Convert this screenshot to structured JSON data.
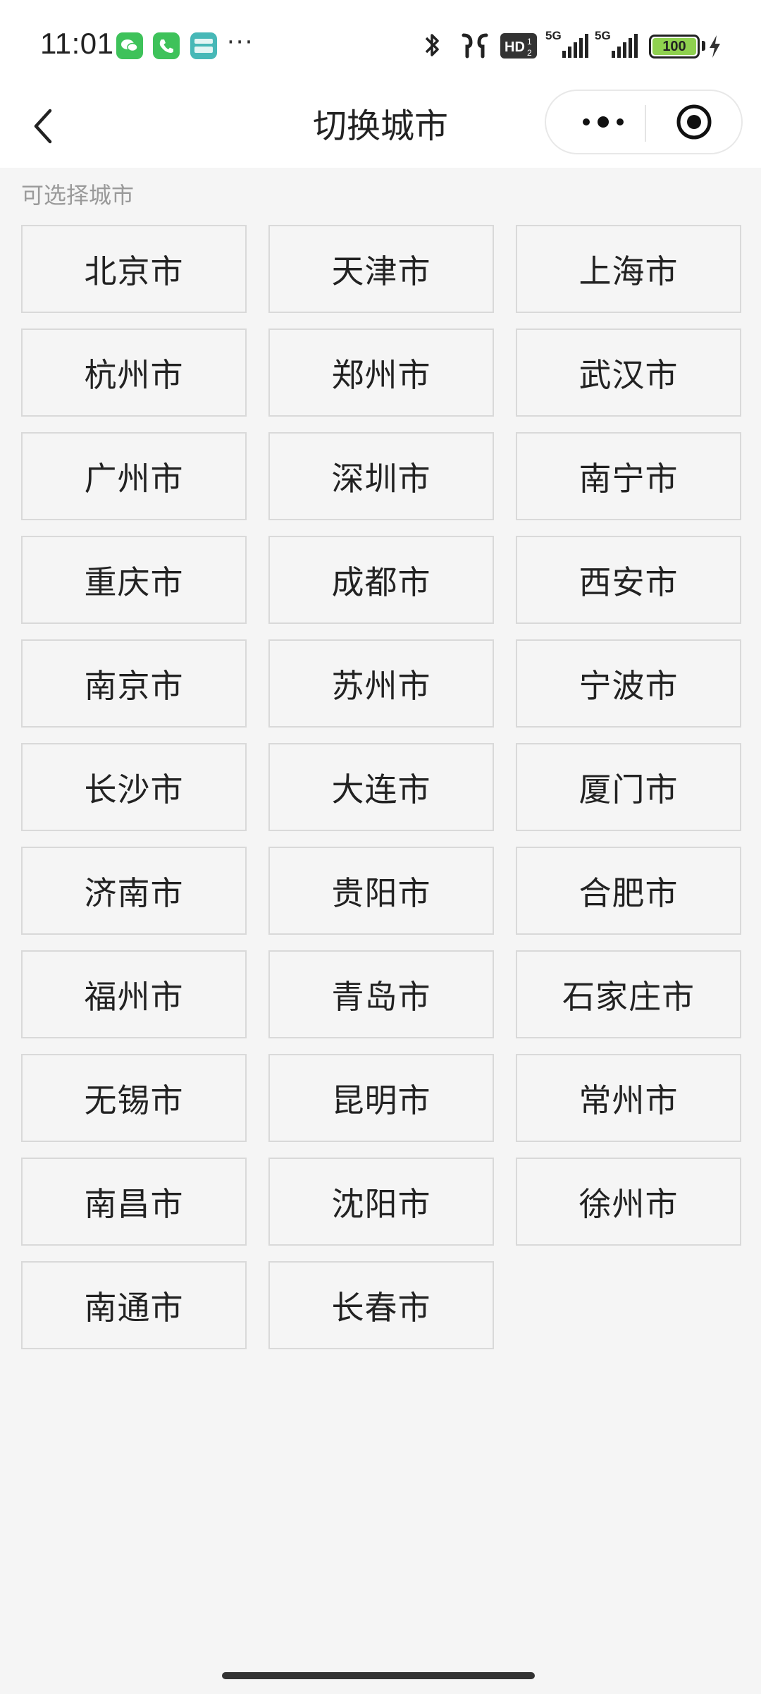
{
  "status_bar": {
    "time": "11:01",
    "notification_icons": [
      "wechat-icon",
      "phone-icon",
      "boss-zhipin-icon"
    ],
    "more": "···",
    "network_1": "5G",
    "network_2": "5G",
    "hd_label": "HD",
    "battery": "100"
  },
  "nav": {
    "title": "切换城市"
  },
  "section_label": "可选择城市",
  "cities": [
    "北京市",
    "天津市",
    "上海市",
    "杭州市",
    "郑州市",
    "武汉市",
    "广州市",
    "深圳市",
    "南宁市",
    "重庆市",
    "成都市",
    "西安市",
    "南京市",
    "苏州市",
    "宁波市",
    "长沙市",
    "大连市",
    "厦门市",
    "济南市",
    "贵阳市",
    "合肥市",
    "福州市",
    "青岛市",
    "石家庄市",
    "无锡市",
    "昆明市",
    "常州市",
    "南昌市",
    "沈阳市",
    "徐州市",
    "南通市",
    "长春市"
  ]
}
